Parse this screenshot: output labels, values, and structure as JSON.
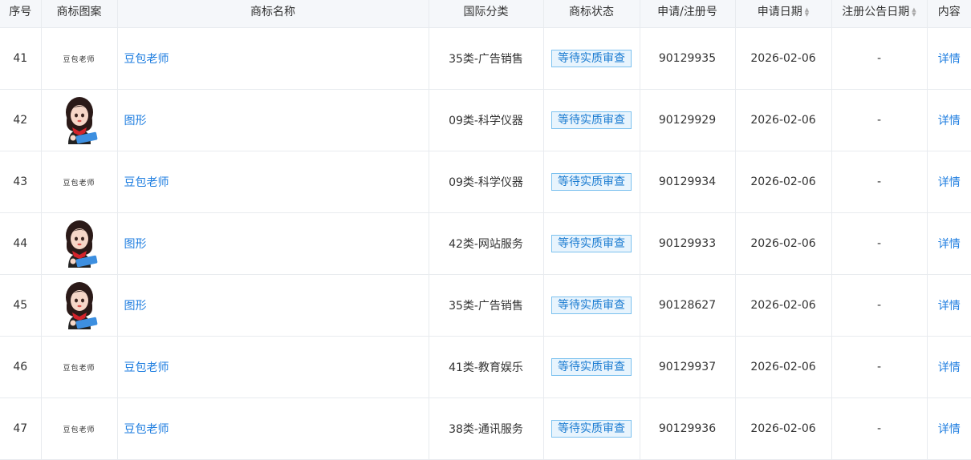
{
  "headers": {
    "seq": "序号",
    "image": "商标图案",
    "name": "商标名称",
    "class": "国际分类",
    "status": "商标状态",
    "appno": "申请/注册号",
    "date": "申请日期",
    "pubdate": "注册公告日期",
    "detail": "内容"
  },
  "rows": [
    {
      "seq": "41",
      "logo_type": "text",
      "logo_text": "豆包老师",
      "name": "豆包老师",
      "class": "35类-广告销售",
      "status": "等待实质审查",
      "appno": "90129935",
      "date": "2026-02-06",
      "pubdate": "-",
      "detail": "详情"
    },
    {
      "seq": "42",
      "logo_type": "avatar",
      "logo_text": "",
      "name": "图形",
      "class": "09类-科学仪器",
      "status": "等待实质审查",
      "appno": "90129929",
      "date": "2026-02-06",
      "pubdate": "-",
      "detail": "详情"
    },
    {
      "seq": "43",
      "logo_type": "text",
      "logo_text": "豆包老师",
      "name": "豆包老师",
      "class": "09类-科学仪器",
      "status": "等待实质审查",
      "appno": "90129934",
      "date": "2026-02-06",
      "pubdate": "-",
      "detail": "详情"
    },
    {
      "seq": "44",
      "logo_type": "avatar",
      "logo_text": "",
      "name": "图形",
      "class": "42类-网站服务",
      "status": "等待实质审查",
      "appno": "90129933",
      "date": "2026-02-06",
      "pubdate": "-",
      "detail": "详情"
    },
    {
      "seq": "45",
      "logo_type": "avatar",
      "logo_text": "",
      "name": "图形",
      "class": "35类-广告销售",
      "status": "等待实质审查",
      "appno": "90128627",
      "date": "2026-02-06",
      "pubdate": "-",
      "detail": "详情"
    },
    {
      "seq": "46",
      "logo_type": "text",
      "logo_text": "豆包老师",
      "name": "豆包老师",
      "class": "41类-教育娱乐",
      "status": "等待实质审查",
      "appno": "90129937",
      "date": "2026-02-06",
      "pubdate": "-",
      "detail": "详情"
    },
    {
      "seq": "47",
      "logo_type": "text",
      "logo_text": "豆包老师",
      "name": "豆包老师",
      "class": "38类-通讯服务",
      "status": "等待实质审查",
      "appno": "90129936",
      "date": "2026-02-06",
      "pubdate": "-",
      "detail": "详情"
    }
  ],
  "colors": {
    "link": "#1f7ee0",
    "badge_bg": "#e8f4fd",
    "badge_border": "#7cc1ef",
    "header_bg": "#f5f7fa",
    "scarf": "#d4232b",
    "book": "#3d8fe0"
  }
}
